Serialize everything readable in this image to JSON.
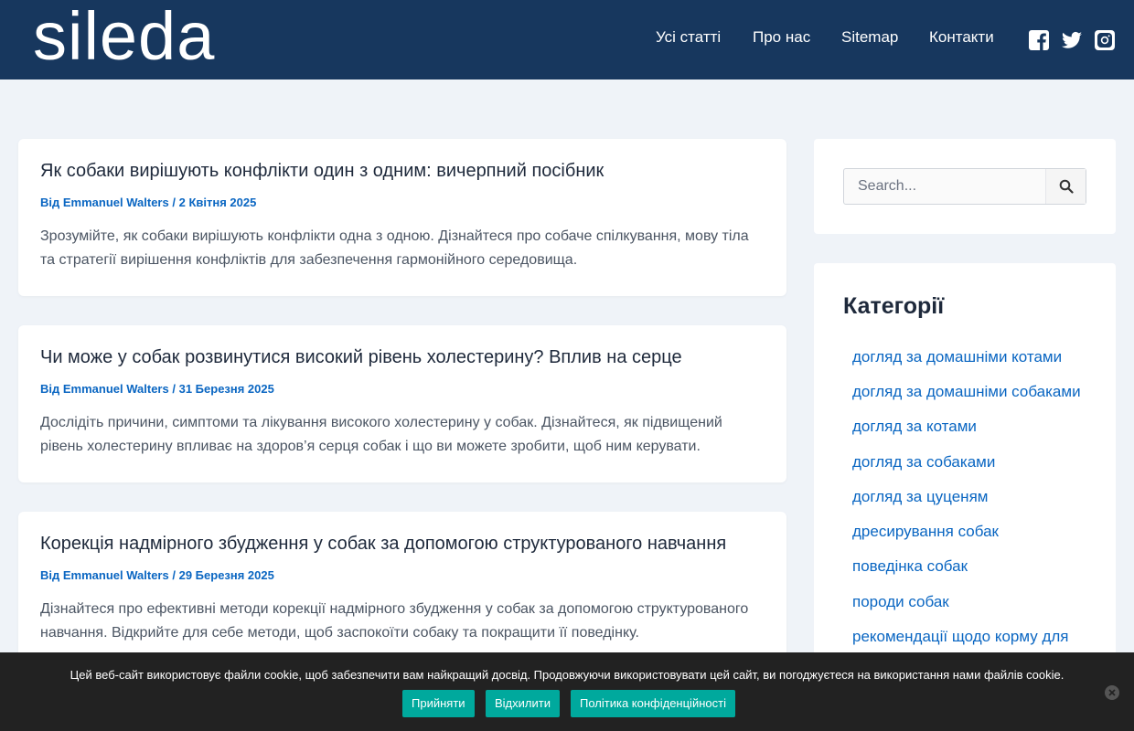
{
  "header": {
    "logo": "sileda",
    "nav": [
      "Усі статті",
      "Про нас",
      "Sitemap",
      "Контакти"
    ],
    "social_icons": [
      "facebook-icon",
      "twitter-icon",
      "instagram-icon"
    ]
  },
  "articles": [
    {
      "title": "Як собаки вирішують конфлікти один з одним: вичерпний посібник",
      "meta_prefix": "Від",
      "author": "Emmanuel Walters",
      "separator": "/",
      "date": "2 Квітня 2025",
      "excerpt": "Зрозумійте, як собаки вирішують конфлікти одна з одною. Дізнайтеся про собаче спілкування, мову тіла та стратегії вирішення конфліктів для забезпечення гармонійного середовища."
    },
    {
      "title": "Чи може у собак розвинутися високий рівень холестерину? Вплив на серце",
      "meta_prefix": "Від",
      "author": "Emmanuel Walters",
      "separator": "/",
      "date": "31 Березня 2025",
      "excerpt": "Дослідіть причини, симптоми та лікування високого холестерину у собак. Дізнайтеся, як підвищений рівень холестерину впливає на здоров’я серця собак і що ви можете зробити, щоб ним керувати."
    },
    {
      "title": "Корекція надмірного збудження у собак за допомогою структурованого навчання",
      "meta_prefix": "Від",
      "author": "Emmanuel Walters",
      "separator": "/",
      "date": "29 Березня 2025",
      "excerpt": "Дізнайтеся про ефективні методи корекції надмірного збудження у собак за допомогою структурованого навчання. Відкрийте для себе методи, щоб заспокоїти собаку та покращити її поведінку."
    }
  ],
  "sidebar": {
    "search_placeholder": "Search...",
    "categories_title": "Категорії",
    "categories": [
      "догляд за домашніми котами",
      "догляд за домашніми собаками",
      "догляд за котами",
      "догляд за собаками",
      "догляд за цуценям",
      "дресирування собак",
      "поведінка собак",
      "породи собак",
      "рекомендації щодо корму для"
    ]
  },
  "cookie": {
    "text": "Цей веб-сайт використовує файли cookie, щоб забезпечити вам найкращий досвід. Продовжуючи використовувати цей сайт, ви погоджуєтеся на використання нами файлів cookie.",
    "accept": "Прийняти",
    "reject": "Відхилити",
    "policy": "Політика конфіденційності"
  },
  "colors": {
    "header_bg": "#17375e",
    "link": "#0a66c2",
    "page_bg": "#eff3f8",
    "cookie_bg": "#222222",
    "cookie_button": "#00a99d"
  }
}
